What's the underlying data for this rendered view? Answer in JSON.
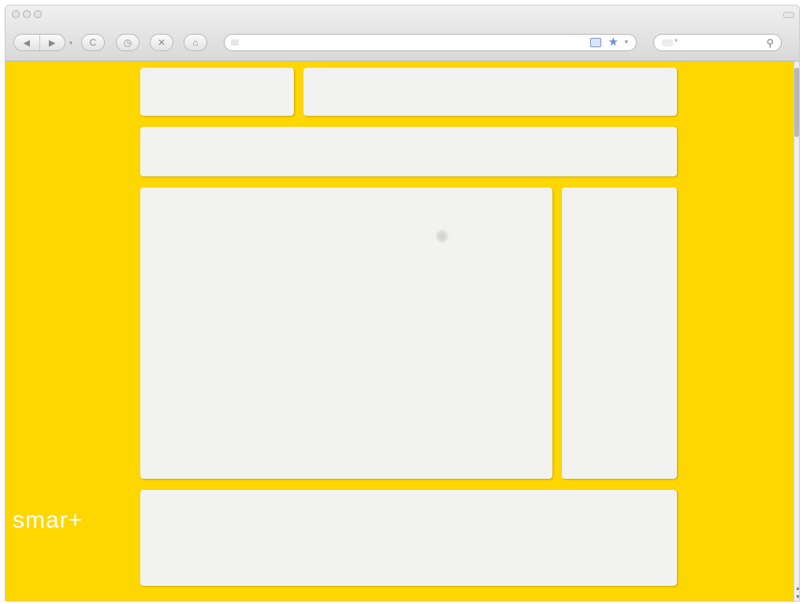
{
  "toolbar": {
    "back_glyph": "◀",
    "forward_glyph": "▶",
    "history_arrow": "▾",
    "reload_glyph": "C",
    "history_glyph": "◷",
    "stop_glyph": "✕",
    "home_glyph": "⌂"
  },
  "address_bar": {
    "url": "",
    "star_glyph": "★",
    "dropdown_glyph": "▾"
  },
  "search_bar": {
    "value": "",
    "magnifier_glyph": "⚲",
    "engine_dropdown_glyph": "▾"
  },
  "colors": {
    "page_background": "#ffd700",
    "panel_background": "#f2f2f0"
  },
  "logo": {
    "text": "smar+",
    "tagline": ""
  }
}
